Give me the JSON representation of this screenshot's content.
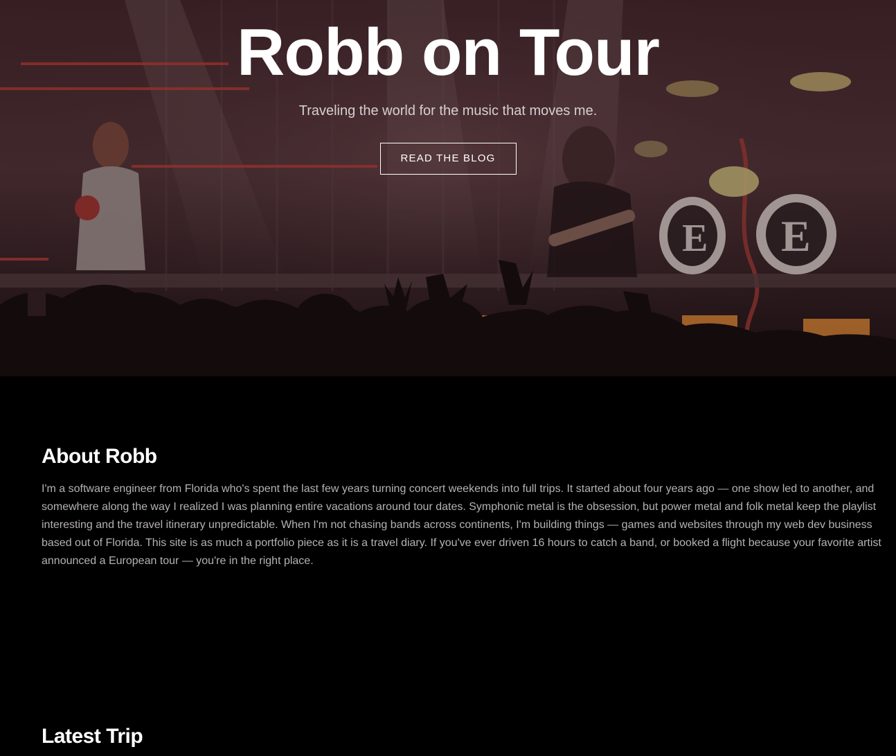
{
  "hero": {
    "title": "Robb on Tour",
    "subtitle": "Traveling the world for the music that moves me.",
    "button_label": "READ THE BLOG",
    "drum_logo_letter": "E"
  },
  "about": {
    "heading": "About Robb",
    "body": "I'm a software engineer from Florida who's spent the last few years turning concert weekends into full trips. It started about four years ago — one show led to another, and somewhere along the way I realized I was planning entire vacations around tour dates. Symphonic metal is the obsession, but power metal and folk metal keep the playlist interesting and the travel itinerary unpredictable. When I'm not chasing bands across continents, I'm building things — games and websites through my web dev business based out of Florida. This site is as much a portfolio piece as it is a travel diary. If you've ever driven 16 hours to catch a band, or booked a flight because your favorite artist announced a European tour — you're in the right place."
  },
  "latest_trip": {
    "heading": "Latest Trip"
  },
  "colors": {
    "page_background": "#000000",
    "heading_text": "#ffffff",
    "body_text": "#b7b2b2",
    "hero_overlay": "#3a1f24"
  }
}
